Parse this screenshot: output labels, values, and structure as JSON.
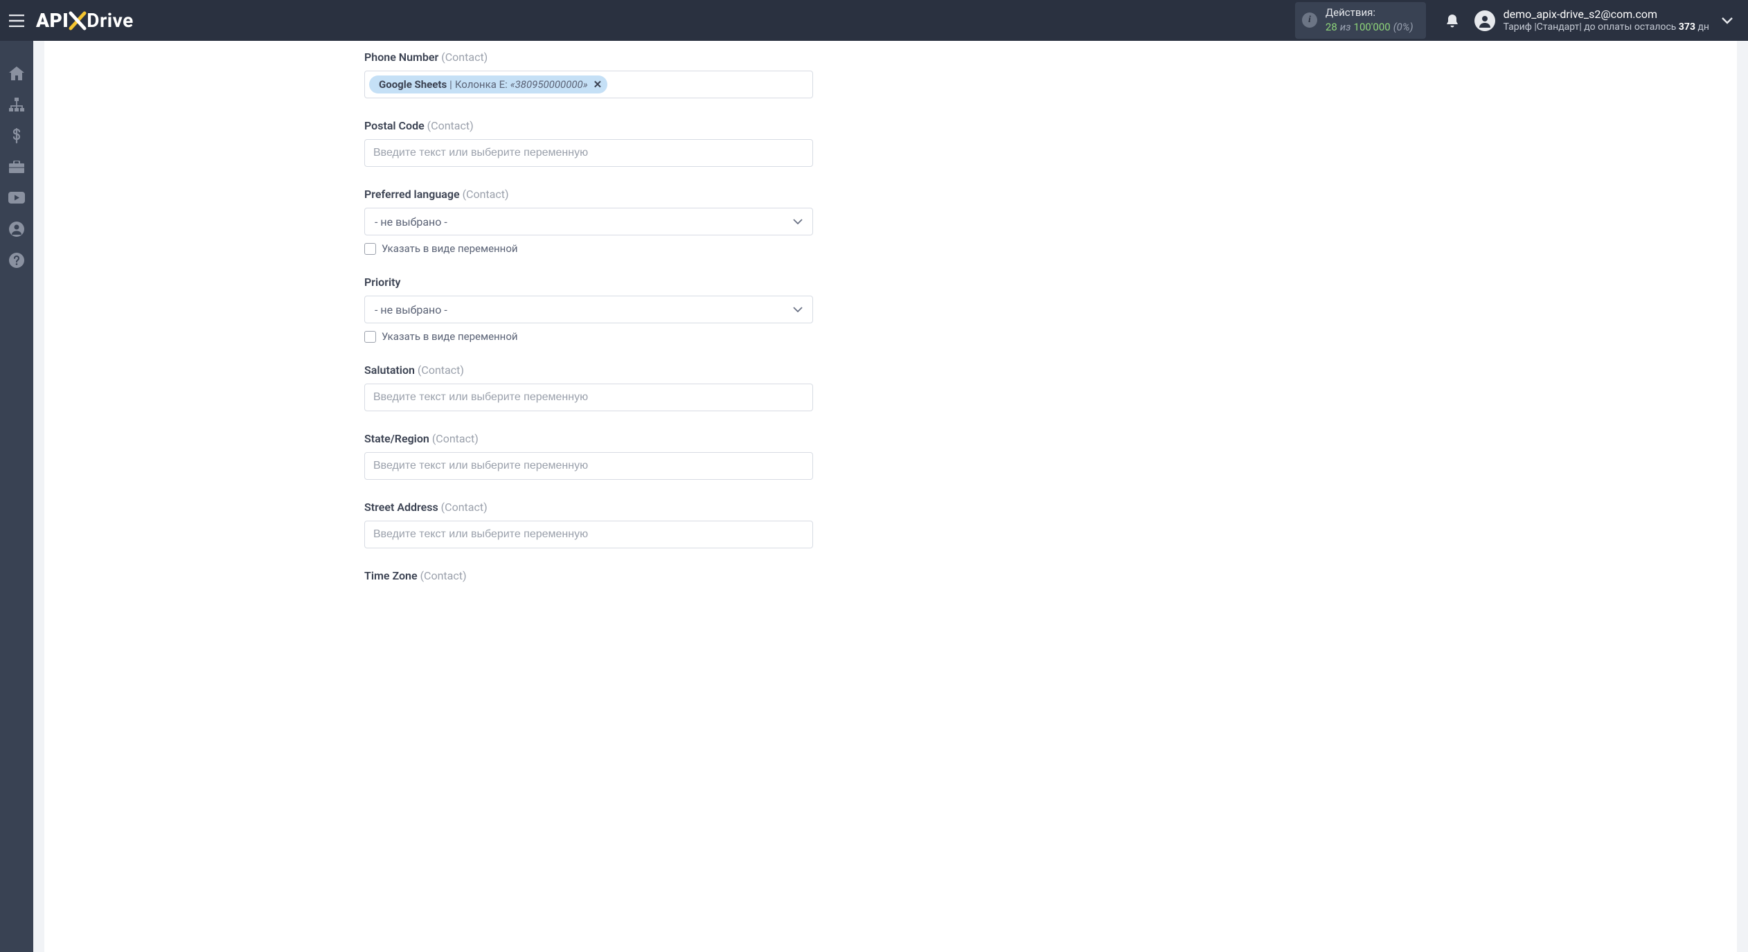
{
  "header": {
    "actions_label": "Действия:",
    "actions_count": "28",
    "actions_of": "из",
    "actions_limit": "100'000",
    "actions_pct": "(0%)",
    "user_email": "demo_apix-drive_s2@com.com",
    "plan_prefix": "Тариф |",
    "plan_name": "Стандарт",
    "plan_suffix": "|  до оплаты осталось ",
    "plan_days": "373",
    "plan_days_unit": " дн"
  },
  "common": {
    "placeholder_text": "Введите текст или выберите переменную",
    "select_empty": "- не выбрано -",
    "var_checkbox_label": "Указать в виде переменной"
  },
  "fields": {
    "phone": {
      "label": "Phone Number",
      "scope": "(Contact)",
      "tag_source": "Google Sheets",
      "tag_sep": " | ",
      "tag_column": "Колонка E: ",
      "tag_value": "«380950000000»"
    },
    "postal": {
      "label": "Postal Code",
      "scope": "(Contact)"
    },
    "lang": {
      "label": "Preferred language",
      "scope": "(Contact)"
    },
    "priority": {
      "label": "Priority",
      "scope": ""
    },
    "salut": {
      "label": "Salutation",
      "scope": "(Contact)"
    },
    "state": {
      "label": "State/Region",
      "scope": "(Contact)"
    },
    "street": {
      "label": "Street Address",
      "scope": "(Contact)"
    },
    "tz": {
      "label": "Time Zone",
      "scope": "(Contact)"
    }
  }
}
